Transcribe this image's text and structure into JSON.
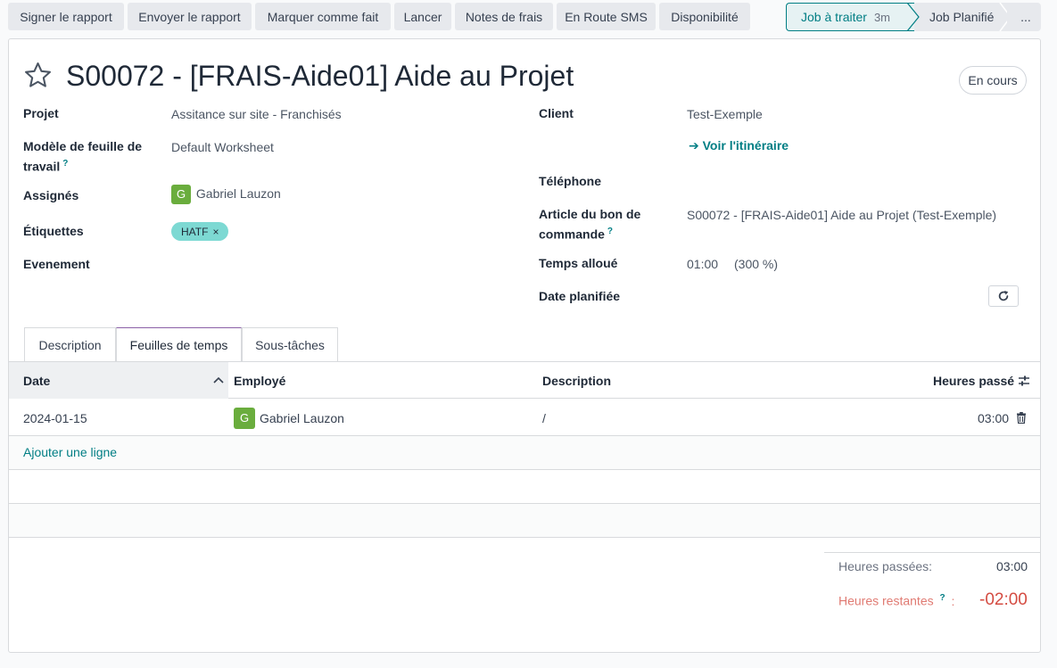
{
  "actions": [
    {
      "label": "Signer le rapport"
    },
    {
      "label": "Envoyer le rapport"
    },
    {
      "label": "Marquer comme fait"
    },
    {
      "label": "Lancer"
    },
    {
      "label": "Notes de frais"
    },
    {
      "label": "En Route SMS"
    },
    {
      "label": "Disponibilité"
    }
  ],
  "stages": {
    "current": {
      "label": "Job à traiter",
      "duration": "3m"
    },
    "next": {
      "label": "Job Planifié"
    },
    "more": "..."
  },
  "record": {
    "title": "S00072 - [FRAIS-Aide01] Aide au Projet",
    "status": "En cours"
  },
  "fields": {
    "projet": {
      "label": "Projet",
      "value": "Assitance sur site - Franchisés"
    },
    "modele": {
      "label_line1": "Modèle de feuille de",
      "label_line2": "travail",
      "help": "?",
      "value": "Default Worksheet"
    },
    "assignes": {
      "label": "Assignés",
      "avatar": "G",
      "value": "Gabriel Lauzon"
    },
    "etiquettes": {
      "label": "Étiquettes",
      "tag": "HATF",
      "remove": "×"
    },
    "evenement": {
      "label": "Evenement"
    },
    "client": {
      "label": "Client",
      "value": "Test-Exemple"
    },
    "itineraire": {
      "arrow": "➔",
      "label": "Voir l'itinéraire"
    },
    "telephone": {
      "label": "Téléphone"
    },
    "article": {
      "label_line1": "Article du bon de",
      "label_line2": "commande",
      "help": "?",
      "value": "S00072 - [FRAIS-Aide01] Aide au Projet (Test-Exemple)"
    },
    "temps": {
      "label": "Temps alloué",
      "value": "01:00",
      "percent": "(300 %)"
    },
    "date_planifiee": {
      "label": "Date planifiée"
    }
  },
  "tabs": [
    {
      "label": "Description"
    },
    {
      "label": "Feuilles de temps",
      "active": true
    },
    {
      "label": "Sous-tâches"
    }
  ],
  "table": {
    "headers": {
      "date": "Date",
      "employe": "Employé",
      "description": "Description",
      "heures": "Heures passé"
    },
    "rows": [
      {
        "date": "2024-01-15",
        "avatar": "G",
        "employe": "Gabriel Lauzon",
        "description": "/",
        "heures": "03:00"
      }
    ],
    "add_line": "Ajouter une ligne"
  },
  "totals": {
    "spent_label": "Heures passées:",
    "spent_value": "03:00",
    "remaining_label": "Heures restantes",
    "remaining_help": "?",
    "remaining_colon": ":",
    "remaining_value": "-02:00"
  },
  "colors": {
    "accent": "#017e84",
    "tab_active_border": "#8a5fa6",
    "negative": "#d44c42",
    "avatar": "#6aad3d",
    "tag": "#7dd9d3"
  },
  "icons": {
    "star": "star-icon",
    "refresh": "refresh-icon",
    "settings": "column-settings-icon",
    "trash": "trash-icon",
    "sort": "sort-asc-icon"
  }
}
